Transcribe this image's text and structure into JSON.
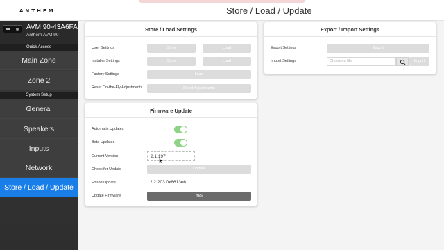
{
  "header": {
    "logo": "ANTHEM",
    "page_title": "Store / Load / Update"
  },
  "device": {
    "name": "AVM 90-43A6FA",
    "model": "Anthem AVM 90"
  },
  "sidebar": {
    "quick_access_label": "Quick Access",
    "system_setup_label": "System Setup",
    "quick_items": [
      {
        "label": "Main Zone"
      },
      {
        "label": "Zone 2"
      }
    ],
    "setup_items": [
      {
        "label": "General"
      },
      {
        "label": "Speakers"
      },
      {
        "label": "Inputs"
      },
      {
        "label": "Network"
      },
      {
        "label": "Store / Load / Update",
        "active": true
      }
    ]
  },
  "store_load": {
    "title": "Store / Load Settings",
    "rows": [
      {
        "label": "User Settings",
        "store": "Store",
        "load": "Load"
      },
      {
        "label": "Installer Settings",
        "store": "Store",
        "load": "Load"
      },
      {
        "label": "Factory Settings",
        "load": "Load"
      },
      {
        "label": "Reset On-the-Fly Adjustments",
        "button": "Reset Adjustments"
      }
    ]
  },
  "export_import": {
    "title": "Export / Import Settings",
    "export_label": "Export Settings",
    "export_button": "Export",
    "import_label": "Import Settings",
    "file_placeholder": "Choose a file",
    "import_button": "Import"
  },
  "firmware": {
    "title": "Firmware Update",
    "automatic_updates_label": "Automatic Updates",
    "automatic_updates_on": true,
    "beta_updates_label": "Beta Updates",
    "beta_updates_on": true,
    "current_version_label": "Current Version",
    "current_version": "2.1.197",
    "check_label": "Check for Update",
    "check_button": "Update",
    "found_label": "Found Update",
    "found_value": "2.2.203.0x8613e6",
    "update_label": "Update Firmware",
    "update_button": "Yes"
  },
  "colors": {
    "accent": "#1a7ee8",
    "toggle_on": "#8fd486",
    "sidebar_bg": "#3a3a3a"
  }
}
